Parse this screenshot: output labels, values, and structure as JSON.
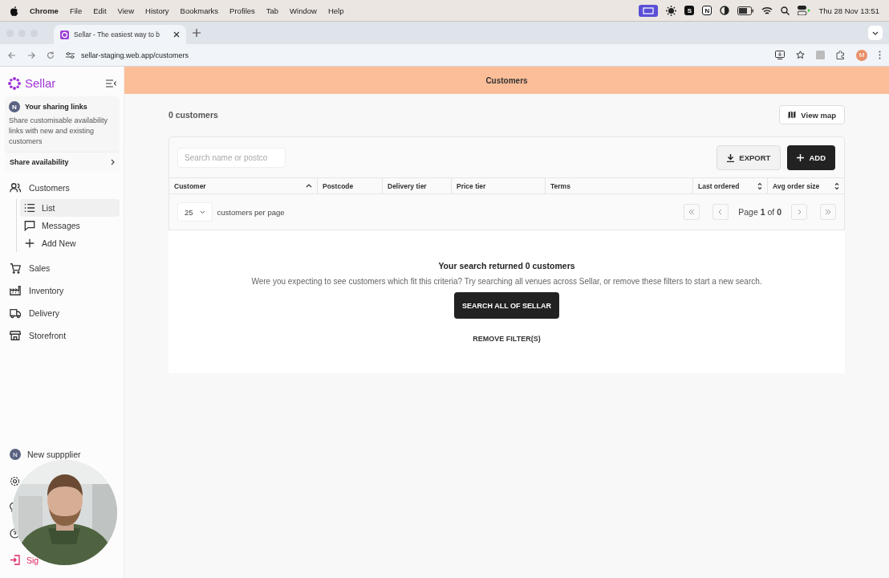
{
  "menubar": {
    "app": "Chrome",
    "menus": [
      "File",
      "Edit",
      "View",
      "History",
      "Bookmarks",
      "Profiles",
      "Tab",
      "Window",
      "Help"
    ],
    "status_badges": [
      "S",
      "N"
    ],
    "clock": "Thu 28 Nov  13:51"
  },
  "browser": {
    "tab_title": "Sellar - The easiest way to b",
    "url": "sellar-staging.web.app/customers",
    "profile_initial": "M"
  },
  "sidebar": {
    "brand": "Sellar",
    "sharing": {
      "avatar": "N",
      "title": "Your sharing links",
      "text": "Share customisable availability links with new and existing customers",
      "link": "Share availability"
    },
    "nav": [
      {
        "label": "Customers",
        "kind": "people",
        "children": [
          {
            "label": "List",
            "kind": "list",
            "selected": true
          },
          {
            "label": "Messages",
            "kind": "message",
            "selected": false
          },
          {
            "label": "Add New",
            "kind": "plus",
            "selected": false
          }
        ]
      },
      {
        "label": "Sales",
        "kind": "cart"
      },
      {
        "label": "Inventory",
        "kind": "factory"
      },
      {
        "label": "Delivery",
        "kind": "truck"
      },
      {
        "label": "Storefront",
        "kind": "store"
      }
    ],
    "account": {
      "avatar": "N",
      "name": "New suppplier"
    },
    "sign_out": "Sig"
  },
  "header": {
    "title": "Customers"
  },
  "count": "0 customers",
  "view_map": "View map",
  "search": {
    "placeholder": "Search name or postco"
  },
  "buttons": {
    "export": "EXPORT",
    "add": "ADD"
  },
  "table": {
    "columns": [
      {
        "label": "Customer",
        "kind": "ascending"
      },
      {
        "label": "Postcode",
        "kind": "plain"
      },
      {
        "label": "Delivery tier",
        "kind": "plain"
      },
      {
        "label": "Price tier",
        "kind": "plain"
      },
      {
        "label": "Terms",
        "kind": "plain"
      },
      {
        "label": "Last ordered",
        "kind": "sortable"
      },
      {
        "label": "Avg order size",
        "kind": "sortable"
      }
    ]
  },
  "pagination": {
    "per_page": "25",
    "per_page_label": "customers per page",
    "page": "Page **1** of **0**"
  },
  "empty": {
    "title": "Your search returned 0 customers",
    "message": "Were you expecting to see customers which fit this criteria? Try searching all venues across Sellar, or remove these filters to start a new search.",
    "search_button": "SEARCH ALL OF SELLAR",
    "remove_link": "REMOVE FILTER(S)"
  }
}
